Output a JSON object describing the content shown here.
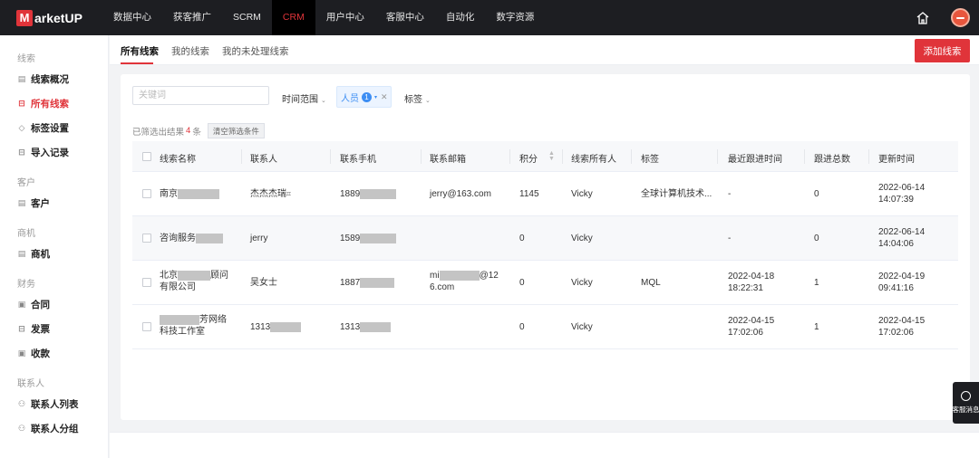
{
  "app": {
    "logo_mark": "M",
    "logo_text": "arketUP"
  },
  "nav": [
    {
      "label": "数据中心",
      "active": false
    },
    {
      "label": "获客推广",
      "active": false
    },
    {
      "label": "SCRM",
      "active": false
    },
    {
      "label": "CRM",
      "active": true
    },
    {
      "label": "用户中心",
      "active": false
    },
    {
      "label": "客服中心",
      "active": false
    },
    {
      "label": "自动化",
      "active": false
    },
    {
      "label": "数字资源",
      "active": false
    }
  ],
  "sidebar": {
    "groups": [
      {
        "title": "线索",
        "items": [
          {
            "label": "线索概况",
            "icon": "overview-icon",
            "active": false
          },
          {
            "label": "所有线索",
            "icon": "list-icon",
            "active": true
          },
          {
            "label": "标签设置",
            "icon": "tag-icon",
            "active": false
          },
          {
            "label": "导入记录",
            "icon": "import-icon",
            "active": false
          }
        ]
      },
      {
        "title": "客户",
        "items": [
          {
            "label": "客户",
            "icon": "customer-icon",
            "active": false
          }
        ]
      },
      {
        "title": "商机",
        "items": [
          {
            "label": "商机",
            "icon": "opportunity-icon",
            "active": false
          }
        ]
      },
      {
        "title": "财务",
        "items": [
          {
            "label": "合同",
            "icon": "contract-icon",
            "active": false
          },
          {
            "label": "发票",
            "icon": "invoice-icon",
            "active": false
          },
          {
            "label": "收款",
            "icon": "payment-icon",
            "active": false
          }
        ]
      },
      {
        "title": "联系人",
        "items": [
          {
            "label": "联系人列表",
            "icon": "contacts-icon",
            "active": false
          },
          {
            "label": "联系人分组",
            "icon": "contact-group-icon",
            "active": false
          }
        ]
      }
    ]
  },
  "tabs": [
    {
      "label": "所有线索",
      "active": true
    },
    {
      "label": "我的线索",
      "active": false
    },
    {
      "label": "我的未处理线索",
      "active": false
    }
  ],
  "add_button": "添加线索",
  "filters": {
    "search_placeholder": "关键词",
    "time_range": "时间范围",
    "person_label": "人员",
    "person_count": "1",
    "tags": "标签"
  },
  "result": {
    "prefix": "已筛选出结果",
    "count": "4",
    "suffix": "条",
    "clear_label": "清空筛选条件"
  },
  "table": {
    "headers": [
      "线索名称",
      "联系人",
      "联系手机",
      "联系邮箱",
      "积分",
      "线索所有人",
      "标签",
      "最近跟进时间",
      "跟进总数",
      "更新时间"
    ],
    "rows": [
      {
        "name1": "南京",
        "name2": "",
        "contact": "杰杰杰瑞",
        "phone": "1889",
        "email1": "jerry@163.com",
        "email2": "",
        "score": "1145",
        "owner": "Vicky",
        "tag": "全球计算机技术...",
        "last1": "-",
        "last2": "",
        "total": "0",
        "upd1": "2022-06-14",
        "upd2": "14:07:39"
      },
      {
        "name1": "咨询服务",
        "name2": "",
        "contact": "jerry",
        "phone": "1589",
        "email1": "",
        "email2": "",
        "score": "0",
        "owner": "Vicky",
        "tag": "",
        "last1": "-",
        "last2": "",
        "total": "0",
        "upd1": "2022-06-14",
        "upd2": "14:04:06"
      },
      {
        "name1": "北京",
        "name1b": "顾问",
        "name2": "有限公司",
        "contact": "吴女士",
        "phone": "1887",
        "email1": "mi",
        "email1b": "@12",
        "email2": "6.com",
        "score": "0",
        "owner": "Vicky",
        "tag": "MQL",
        "last1": "2022-04-18",
        "last2": "18:22:31",
        "total": "1",
        "upd1": "2022-04-19",
        "upd2": "09:41:16"
      },
      {
        "name1": "",
        "name1b": "芳网络",
        "name2": "科技工作室",
        "contact": "1313",
        "phone": "1313",
        "email1": "",
        "email2": "",
        "score": "0",
        "owner": "Vicky",
        "tag": "",
        "last1": "2022-04-15",
        "last2": "17:02:06",
        "total": "1",
        "upd1": "2022-04-15",
        "upd2": "17:02:06"
      }
    ]
  },
  "cs_float": "客服消息",
  "colors": {
    "brand": "#e0343a",
    "topbar": "#1d1e22",
    "chip": "#3d8ef3"
  }
}
